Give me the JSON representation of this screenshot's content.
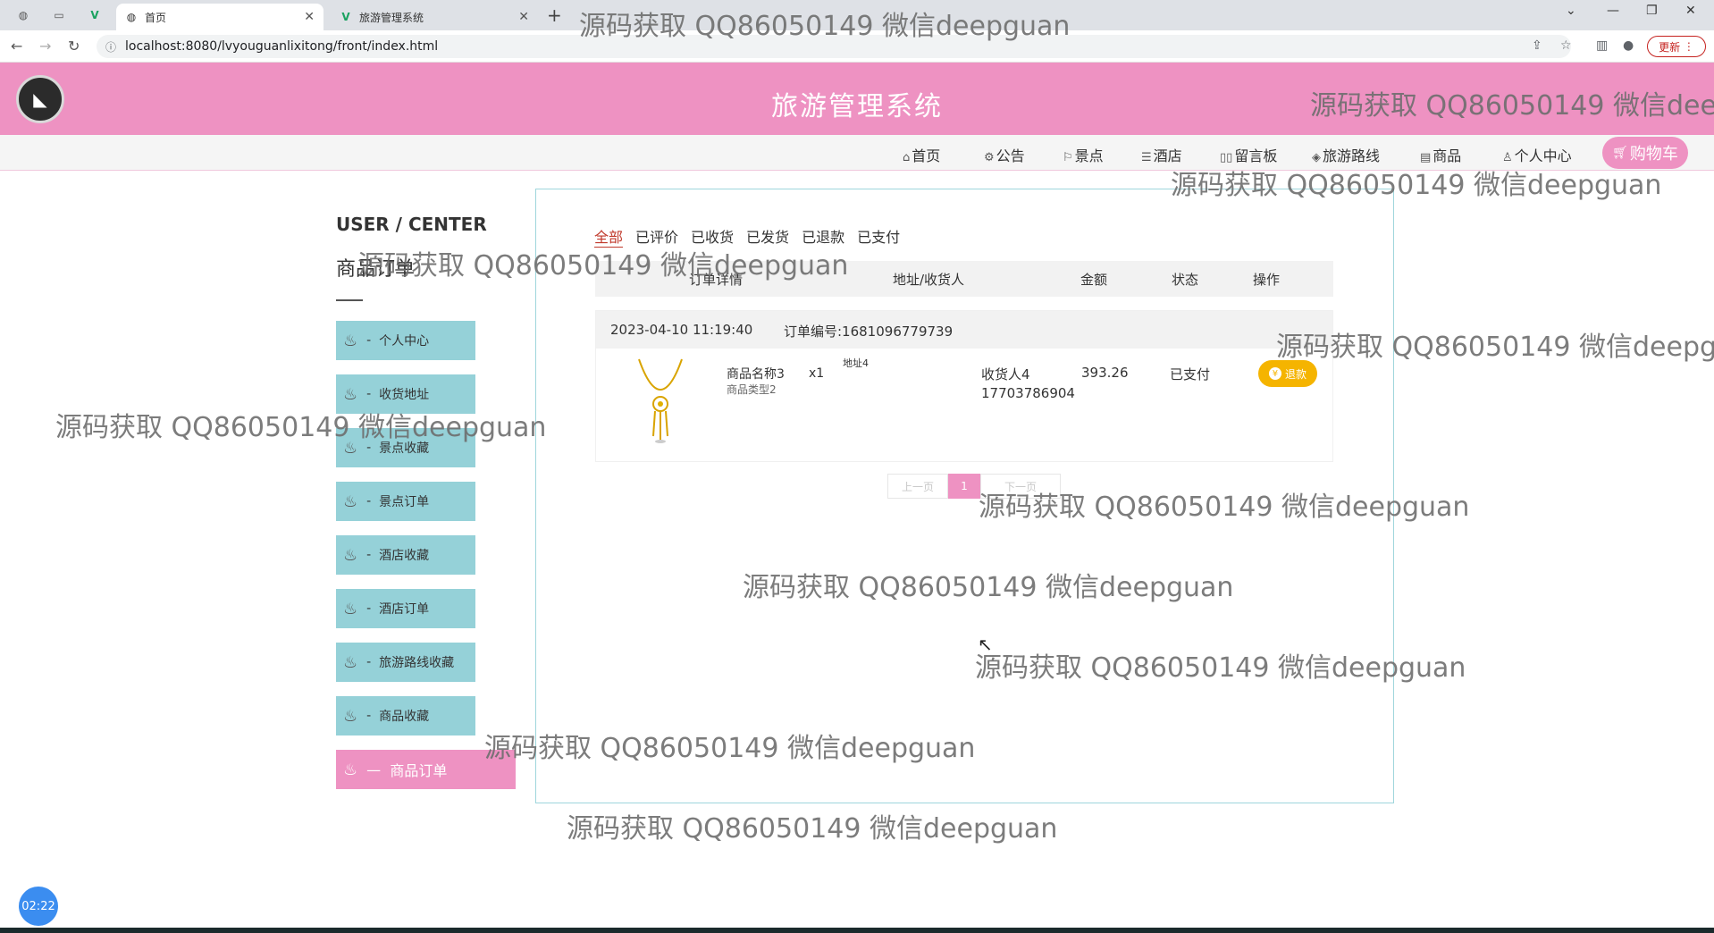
{
  "browser": {
    "tabs": [
      {
        "label": "首页",
        "active": true
      },
      {
        "label": "旅游管理系统",
        "active": false
      }
    ],
    "new_tab_glyph": "+",
    "url": "localhost:8080/lvyouguanlixitong/front/index.html",
    "update_label": "更新"
  },
  "site": {
    "title": "旅游管理系统",
    "nav": [
      {
        "icon": "home-icon",
        "label": "首页"
      },
      {
        "icon": "announcement-icon",
        "label": "公告"
      },
      {
        "icon": "flag-icon",
        "label": "景点"
      },
      {
        "icon": "hotel-icon",
        "label": "酒店"
      },
      {
        "icon": "message-board-icon",
        "label": "留言板"
      },
      {
        "icon": "route-icon",
        "label": "旅游路线"
      },
      {
        "icon": "goods-icon",
        "label": "商品"
      },
      {
        "icon": "user-icon",
        "label": "个人中心"
      }
    ],
    "cart_label": "购物车"
  },
  "user_center": {
    "title": "USER / CENTER",
    "subtitle": "商品订单",
    "menu": [
      {
        "label": "个人中心",
        "active": false
      },
      {
        "label": "收货地址",
        "active": false
      },
      {
        "label": "景点收藏",
        "active": false
      },
      {
        "label": "景点订单",
        "active": false
      },
      {
        "label": "酒店收藏",
        "active": false
      },
      {
        "label": "酒店订单",
        "active": false
      },
      {
        "label": "旅游路线收藏",
        "active": false
      },
      {
        "label": "商品收藏",
        "active": false
      },
      {
        "label": "商品订单",
        "active": true
      }
    ]
  },
  "orders": {
    "filters": [
      "全部",
      "已评价",
      "已收货",
      "已发货",
      "已退款",
      "已支付"
    ],
    "active_filter": "全部",
    "columns": [
      "订单详情",
      "地址/收货人",
      "金额",
      "状态",
      "操作"
    ],
    "list": [
      {
        "datetime": "2023-04-10 11:19:40",
        "order_no": "订单编号:1681096779739",
        "product_name": "商品名称3",
        "product_type": "商品类型2",
        "quantity": "x1",
        "address": "地址4",
        "receiver": "收货人4",
        "phone": "17703786904",
        "amount": "393.26",
        "status": "已支付",
        "action": "退款"
      }
    ],
    "pager": {
      "prev": "上一页",
      "current": "1",
      "next": "下一页"
    }
  },
  "watermark_text": "源码获取 QQ86050149 微信deepguan",
  "watermark_cut": "源码获取 QQ86050149 微信deep",
  "watermark_cut2": "源码获取 QQ86050149 微信deepgu",
  "timer": "02:22",
  "colors": {
    "header_pink": "#ee92c2",
    "menu_teal": "#95d1d8",
    "refund_gold": "#f5b400",
    "active_filter_red": "#c0392b"
  }
}
